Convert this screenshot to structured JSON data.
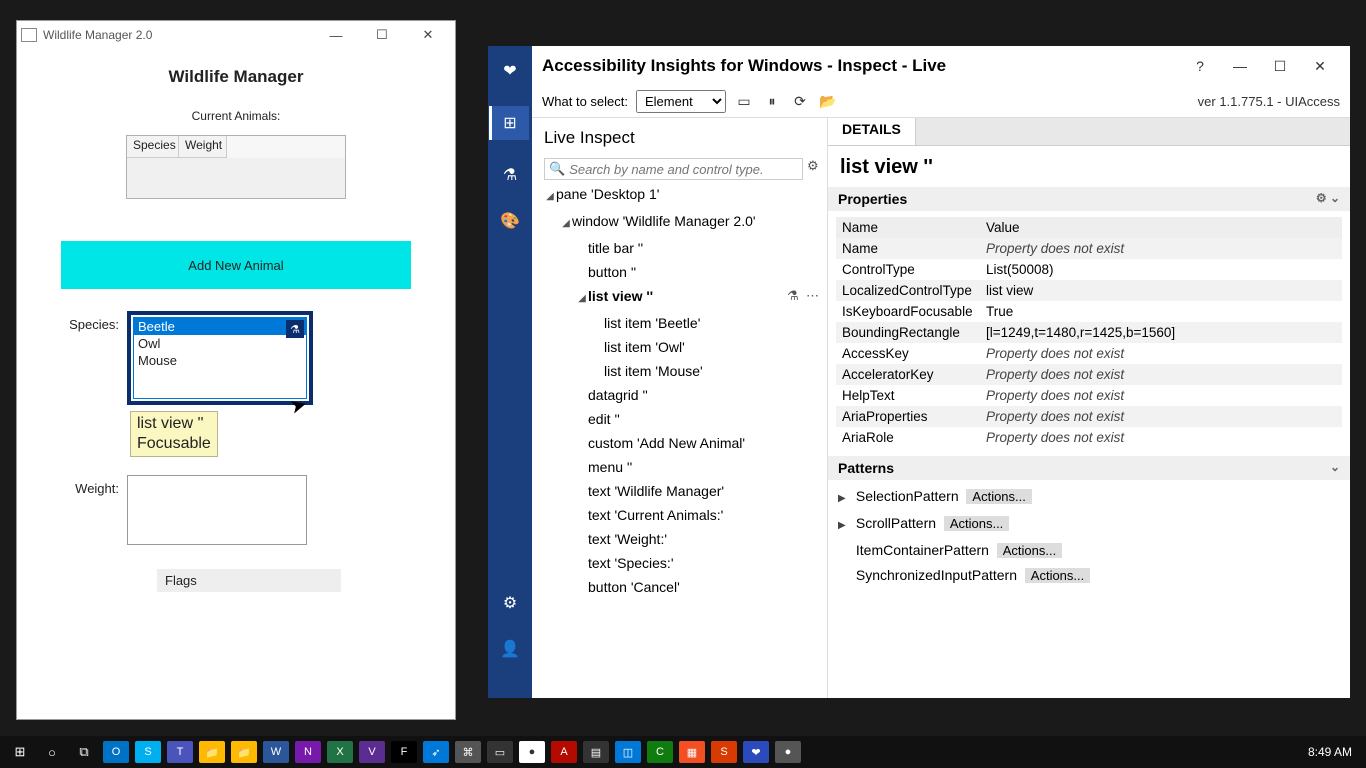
{
  "leftApp": {
    "windowTitle": "Wildlife Manager 2.0",
    "heading": "Wildlife Manager",
    "currentAnimalsLabel": "Current Animals:",
    "grid": {
      "col1": "Species",
      "col2": "Weight"
    },
    "addButton": "Add New Animal",
    "speciesLabel": "Species:",
    "speciesItems": [
      "Beetle",
      "Owl",
      "Mouse"
    ],
    "tooltipLine1": "list view ''",
    "tooltipLine2": "Focusable",
    "weightLabel": "Weight:",
    "flagsLabel": "Flags"
  },
  "inspector": {
    "title": "Accessibility Insights for Windows - Inspect - Live",
    "whatToSelect": "What to select:",
    "selectValue": "Element",
    "version": "ver 1.1.775.1 - UIAccess",
    "liveInspect": "Live Inspect",
    "searchPlaceholder": "Search by name and control type.",
    "tree": {
      "root": "pane 'Desktop 1'",
      "window": "window 'Wildlife Manager 2.0'",
      "titlebar": "title bar ''",
      "button1": "button ''",
      "listview": "list view ''",
      "li_beetle": "list item 'Beetle'",
      "li_owl": "list item 'Owl'",
      "li_mouse": "list item 'Mouse'",
      "datagrid": "datagrid ''",
      "edit": "edit ''",
      "custom": "custom 'Add New Animal'",
      "menu": "menu ''",
      "text_wm": "text 'Wildlife Manager'",
      "text_ca": "text 'Current Animals:'",
      "text_w": "text 'Weight:'",
      "text_s": "text 'Species:'",
      "cancel": "button 'Cancel'"
    },
    "detailsTab": "DETAILS",
    "elemHeader": "list view ''",
    "propsHeader": "Properties",
    "nameCol": "Name",
    "valueCol": "Value",
    "props": [
      {
        "n": "Name",
        "v": "Property does not exist",
        "dne": true
      },
      {
        "n": "ControlType",
        "v": "List(50008)",
        "dne": false
      },
      {
        "n": "LocalizedControlType",
        "v": "list view",
        "dne": false
      },
      {
        "n": "IsKeyboardFocusable",
        "v": "True",
        "dne": false
      },
      {
        "n": "BoundingRectangle",
        "v": "[l=1249,t=1480,r=1425,b=1560]",
        "dne": false
      },
      {
        "n": "AccessKey",
        "v": "Property does not exist",
        "dne": true
      },
      {
        "n": "AcceleratorKey",
        "v": "Property does not exist",
        "dne": true
      },
      {
        "n": "HelpText",
        "v": "Property does not exist",
        "dne": true
      },
      {
        "n": "AriaProperties",
        "v": "Property does not exist",
        "dne": true
      },
      {
        "n": "AriaRole",
        "v": "Property does not exist",
        "dne": true
      }
    ],
    "patternsHeader": "Patterns",
    "patterns": [
      {
        "name": "SelectionPattern",
        "actions": "Actions...",
        "exp": true
      },
      {
        "name": "ScrollPattern",
        "actions": "Actions...",
        "exp": true
      },
      {
        "name": "ItemContainerPattern",
        "actions": "Actions...",
        "exp": false
      },
      {
        "name": "SynchronizedInputPattern",
        "actions": "Actions...",
        "exp": false
      }
    ]
  },
  "taskbar": {
    "clock": "8:49 AM"
  }
}
